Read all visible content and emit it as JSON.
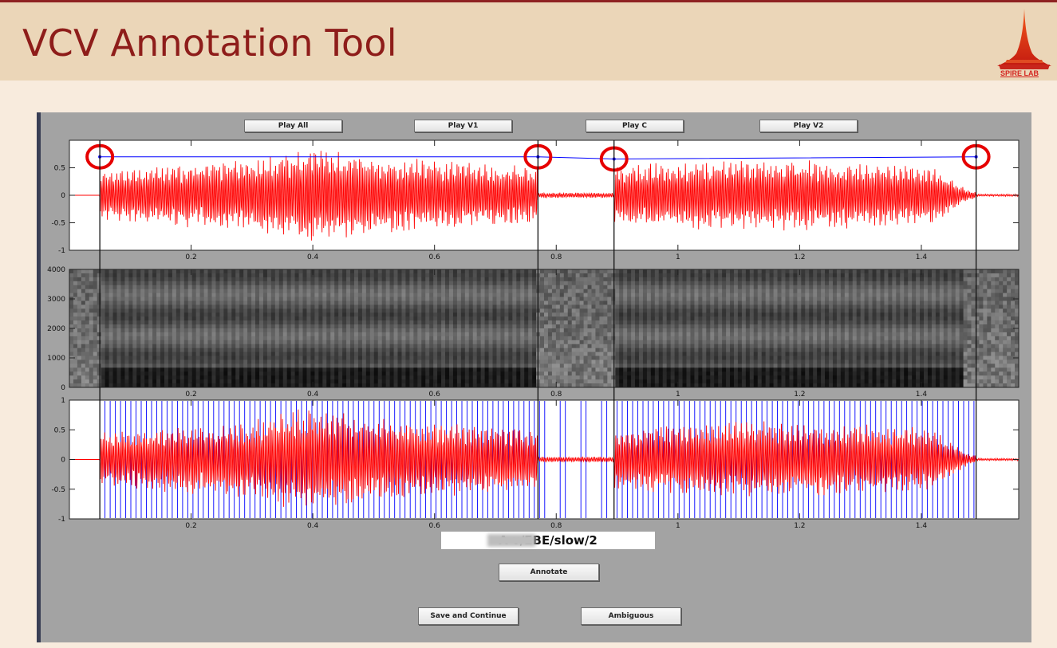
{
  "header": {
    "title": "VCV Annotation Tool",
    "logo_text": "SPIRE LAB"
  },
  "buttons": {
    "play_all": "Play All",
    "play_v1": "Play V1",
    "play_c": "Play C",
    "play_v2": "Play V2",
    "annotate": "Annotate",
    "save_continue": "Save and Continue",
    "ambiguous": "Ambiguous"
  },
  "file_label": "A        v/EBE/slow/2",
  "colors": {
    "waveform": "#ff0000",
    "marker": "#0000ff",
    "circle": "#e60000",
    "panel": "#a3a3a3"
  },
  "chart_data": [
    {
      "type": "line",
      "name": "waveform",
      "xlim": [
        0.0,
        1.56
      ],
      "ylim": [
        -1,
        1
      ],
      "xticks": [
        0.2,
        0.4,
        0.6,
        0.8,
        1,
        1.2,
        1.4
      ],
      "xtick_labels": [
        "0.2",
        "0.4",
        "0.6",
        "0.8",
        "1",
        "1.2",
        "1.4"
      ],
      "yticks": [
        0.5,
        0,
        -0.5,
        -1
      ],
      "ytick_labels": [
        "0.5",
        "0",
        "-0.5",
        "-1"
      ],
      "segment_boundaries": [
        0.05,
        0.77,
        0.895,
        1.49
      ],
      "marker_points": [
        {
          "x": 0.05,
          "y": 0.7
        },
        {
          "x": 0.77,
          "y": 0.7
        },
        {
          "x": 0.895,
          "y": 0.66
        },
        {
          "x": 1.49,
          "y": 0.7
        }
      ]
    },
    {
      "type": "heatmap",
      "name": "spectrogram",
      "xlim": [
        0.0,
        1.56
      ],
      "ylim": [
        0,
        4000
      ],
      "xticks": [
        0.2,
        0.4,
        0.6,
        0.8,
        1,
        1.2,
        1.4
      ],
      "xtick_labels": [
        "0.2",
        "0.4",
        "0.6",
        "0.8",
        "1",
        "1.2",
        "1.4"
      ],
      "yticks": [
        4000,
        3000,
        2000,
        1000,
        0
      ],
      "ytick_labels": [
        "4000",
        "3000",
        "2000",
        "1000",
        "0"
      ]
    },
    {
      "type": "line",
      "name": "pitch-marks",
      "xlim": [
        0.0,
        1.56
      ],
      "ylim": [
        -1,
        1
      ],
      "xticks": [
        0.2,
        0.4,
        0.6,
        0.8,
        1,
        1.2,
        1.4
      ],
      "xtick_labels": [
        "0.2",
        "0.4",
        "0.6",
        "0.8",
        "1",
        "1.2",
        "1.4"
      ],
      "yticks": [
        1,
        0.5,
        0,
        -0.5,
        -1
      ],
      "ytick_labels": [
        "1",
        "0.5",
        "0",
        "-0.5",
        "-1"
      ]
    }
  ]
}
